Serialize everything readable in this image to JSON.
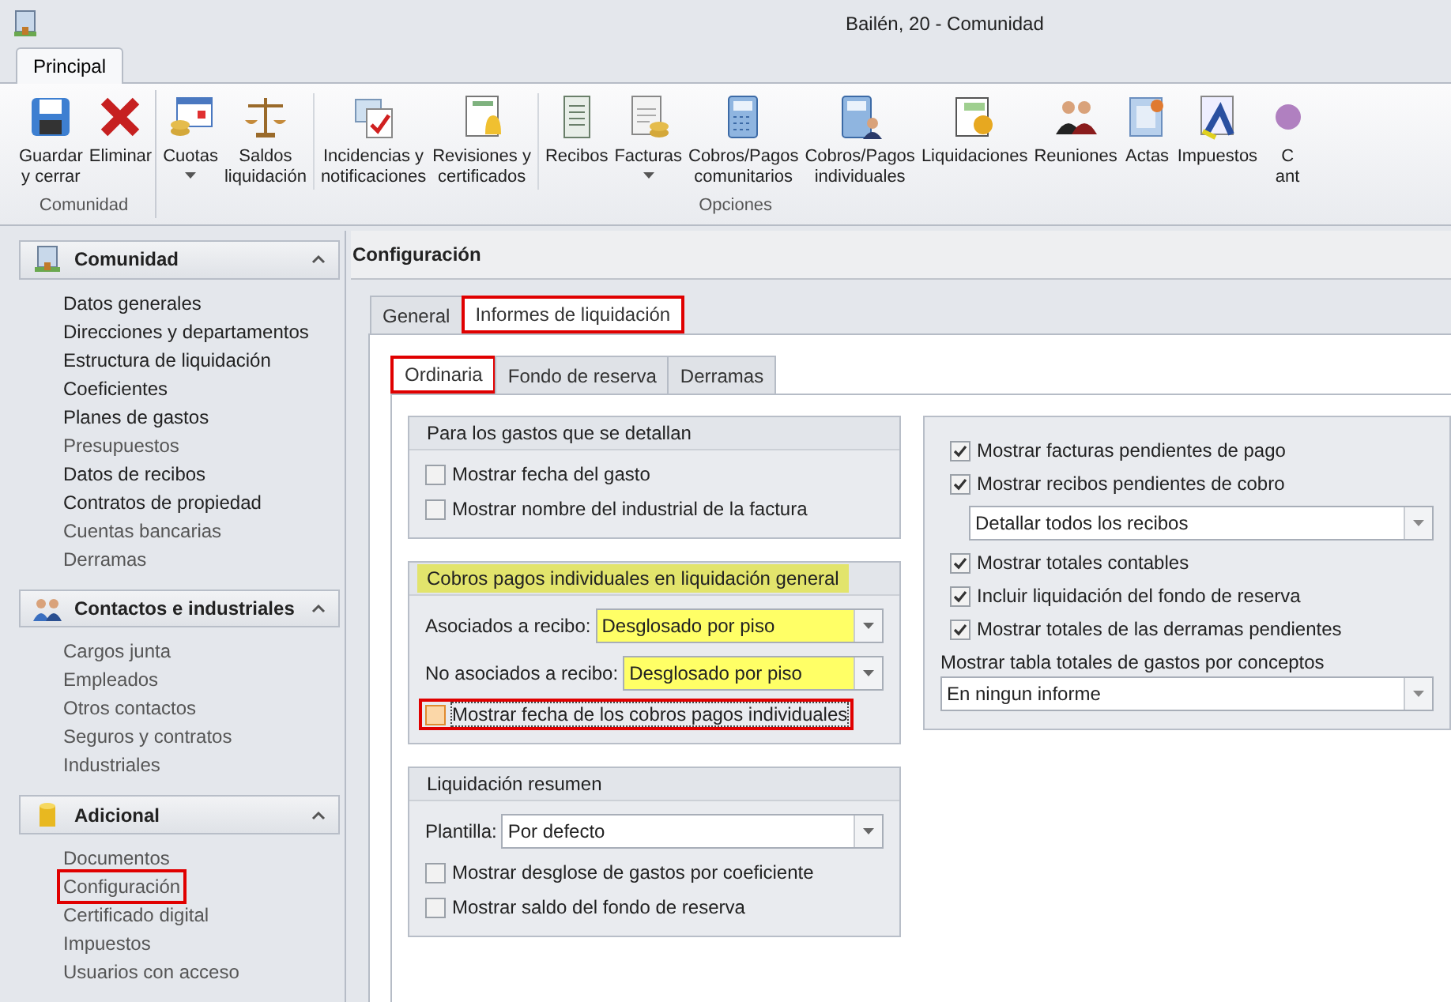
{
  "window": {
    "title": "Bailén, 20 - Comunidad"
  },
  "ribbon_tabs": [
    {
      "label": "Principal",
      "selected": true
    }
  ],
  "ribbon_groups": [
    {
      "label": "Comunidad",
      "sections": [
        [
          {
            "label": [
              "Guardar",
              "y cerrar"
            ],
            "dropdown": false
          },
          {
            "label": [
              "Eliminar"
            ],
            "dropdown": false
          }
        ]
      ]
    },
    {
      "label": "Opciones",
      "sections": [
        [
          {
            "label": [
              "Cuotas"
            ],
            "dropdown": true
          },
          {
            "label": [
              "Saldos",
              "liquidación"
            ],
            "dropdown": false
          }
        ],
        [
          {
            "label": [
              "Incidencias y",
              "notificaciones"
            ],
            "dropdown": false
          },
          {
            "label": [
              "Revisiones y",
              "certificados"
            ],
            "dropdown": false
          }
        ],
        [
          {
            "label": [
              "Recibos"
            ],
            "dropdown": false
          },
          {
            "label": [
              "Facturas"
            ],
            "dropdown": true
          },
          {
            "label": [
              "Cobros/Pagos",
              "comunitarios"
            ],
            "dropdown": false
          },
          {
            "label": [
              "Cobros/Pagos",
              "individuales"
            ],
            "dropdown": false
          },
          {
            "label": [
              "Liquidaciones"
            ],
            "dropdown": false
          },
          {
            "label": [
              "Reuniones"
            ],
            "dropdown": false
          },
          {
            "label": [
              "Actas"
            ],
            "dropdown": false
          },
          {
            "label": [
              "Impuestos"
            ],
            "dropdown": false
          },
          {
            "label": [
              "C",
              "ant"
            ],
            "dropdown": false
          }
        ]
      ]
    }
  ],
  "sidebar": {
    "sections": [
      {
        "title": "Comunidad",
        "expanded": true,
        "items": [
          {
            "label": "Datos generales",
            "disabled": false,
            "selected": false
          },
          {
            "label": "Direcciones y departamentos",
            "disabled": false,
            "selected": false
          },
          {
            "label": "Estructura de liquidación",
            "disabled": false,
            "selected": false
          },
          {
            "label": "Coeficientes",
            "disabled": false,
            "selected": false
          },
          {
            "label": "Planes de gastos",
            "disabled": false,
            "selected": false
          },
          {
            "label": "Presupuestos",
            "disabled": true,
            "selected": false
          },
          {
            "label": "Datos de recibos",
            "disabled": false,
            "selected": false
          },
          {
            "label": "Contratos de propiedad",
            "disabled": false,
            "selected": false
          },
          {
            "label": "Cuentas bancarias",
            "disabled": true,
            "selected": false
          },
          {
            "label": "Derramas",
            "disabled": true,
            "selected": false
          }
        ]
      },
      {
        "title": "Contactos e industriales",
        "expanded": true,
        "items": [
          {
            "label": "Cargos junta",
            "disabled": true,
            "selected": false
          },
          {
            "label": "Empleados",
            "disabled": true,
            "selected": false
          },
          {
            "label": "Otros contactos",
            "disabled": true,
            "selected": false
          },
          {
            "label": "Seguros y contratos",
            "disabled": true,
            "selected": false
          },
          {
            "label": "Industriales",
            "disabled": true,
            "selected": false
          }
        ]
      },
      {
        "title": "Adicional",
        "expanded": true,
        "items": [
          {
            "label": "Documentos",
            "disabled": true,
            "selected": false
          },
          {
            "label": "Configuración",
            "disabled": true,
            "selected": true
          },
          {
            "label": "Certificado digital",
            "disabled": true,
            "selected": false
          },
          {
            "label": "Impuestos",
            "disabled": true,
            "selected": false
          },
          {
            "label": "Usuarios con acceso",
            "disabled": true,
            "selected": false
          }
        ]
      }
    ]
  },
  "content": {
    "title": "Configuración",
    "tabs": [
      {
        "label": "General",
        "selected": false
      },
      {
        "label": "Informes de liquidación",
        "selected": true
      }
    ],
    "subtabs": [
      {
        "label": "Ordinaria",
        "selected": true
      },
      {
        "label": "Fondo de reserva",
        "selected": false
      },
      {
        "label": "Derramas",
        "selected": false
      }
    ],
    "groups": [
      {
        "title": "Para los gastos que se detallan",
        "highlighted": false,
        "rows": [
          {
            "kind": "checkbox",
            "label": "Mostrar fecha del gasto",
            "checked": false,
            "highlighted": false
          },
          {
            "kind": "checkbox",
            "label": "Mostrar nombre del industrial de la factura",
            "checked": false,
            "highlighted": false
          }
        ]
      },
      {
        "title": "Cobros pagos individuales en liquidación general",
        "highlighted": true,
        "rows": [
          {
            "kind": "select",
            "label": "Asociados a recibo:",
            "value": "Desglosado por piso",
            "highlighted": true
          },
          {
            "kind": "select",
            "label": "No asociados a recibo:",
            "value": "Desglosado por piso",
            "highlighted": true
          },
          {
            "kind": "checkbox",
            "label": "Mostrar fecha de los cobros pagos individuales",
            "checked": false,
            "highlighted": true
          }
        ]
      },
      {
        "title": "Liquidación resumen",
        "highlighted": false,
        "rows": [
          {
            "kind": "select",
            "label": "Plantilla:",
            "value": "Por defecto",
            "highlighted": false
          },
          {
            "kind": "checkbox",
            "label": "Mostrar desglose de gastos por coeficiente",
            "checked": false,
            "highlighted": false
          },
          {
            "kind": "checkbox",
            "label": "Mostrar saldo del fondo de reserva",
            "checked": false,
            "highlighted": false
          }
        ]
      }
    ],
    "options": [
      {
        "kind": "checkbox",
        "label": "Mostrar facturas pendientes de pago",
        "checked": true
      },
      {
        "kind": "checkbox",
        "label": "Mostrar recibos pendientes de cobro",
        "checked": true
      },
      {
        "kind": "subselect",
        "value": "Detallar todos los recibos"
      },
      {
        "kind": "checkbox",
        "label": "Mostrar totales contables",
        "checked": true
      },
      {
        "kind": "checkbox",
        "label": "Incluir liquidación del fondo de reserva",
        "checked": true
      },
      {
        "kind": "checkbox",
        "label": "Mostrar totales de las derramas pendientes",
        "checked": true
      },
      {
        "kind": "label",
        "label": "Mostrar tabla totales de gastos por conceptos"
      },
      {
        "kind": "select",
        "value": "En ningun informe"
      }
    ]
  }
}
